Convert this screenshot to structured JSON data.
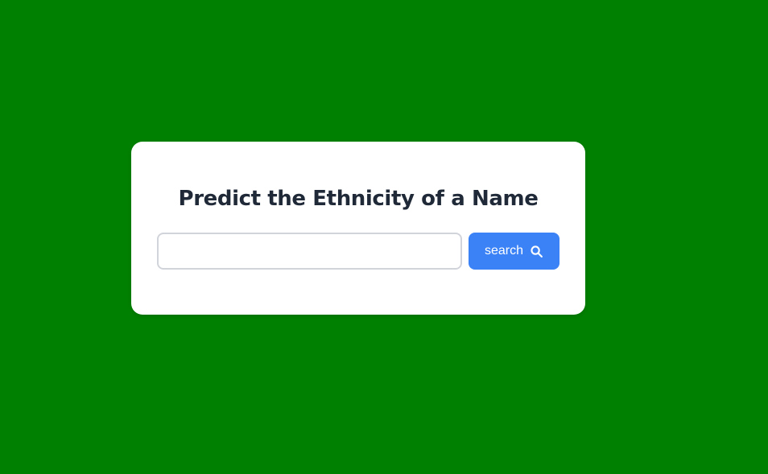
{
  "page": {
    "background_color": "#008000"
  },
  "card": {
    "title": "Predict the Ethnicity of a Name",
    "search": {
      "value": "",
      "placeholder": "",
      "button_label": "search",
      "button_icon": "search-icon",
      "button_color": "#3b82f6"
    }
  }
}
